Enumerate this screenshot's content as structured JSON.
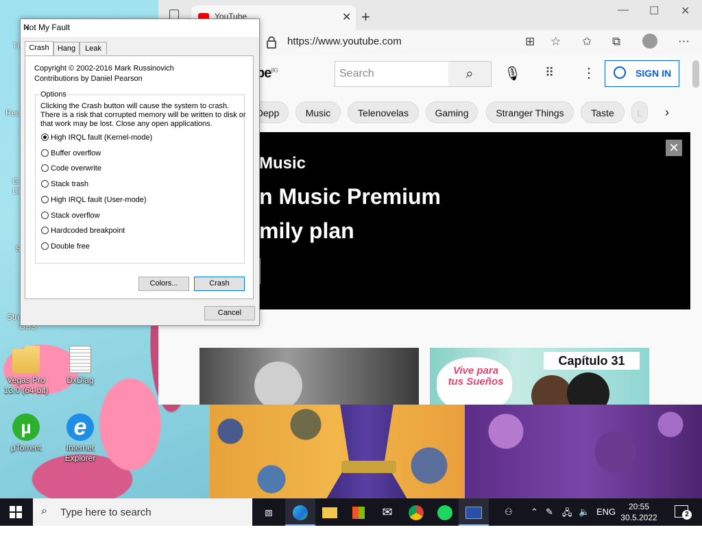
{
  "desktop": {
    "icons": [
      {
        "label": "Vegas Pro 13.0 (64-bit)"
      },
      {
        "label": "DxDiag"
      },
      {
        "label": "µTorrent"
      },
      {
        "label": "Internet Explorer"
      }
    ],
    "edge_labels": [
      "Th",
      "Rec",
      "G",
      "Ch",
      "S",
      "Stre",
      "OBS"
    ]
  },
  "browser": {
    "tab_title": "YouTube",
    "url": "https://www.youtube.com",
    "youtube": {
      "logo_suffix": "be",
      "country": "BG",
      "search_placeholder": "Search",
      "sign_in": "SIGN IN",
      "chips": [
        "Depp",
        "Music",
        "Telenovelas",
        "Gaming",
        "Stranger Things",
        "Taste",
        "L"
      ],
      "ad": {
        "line1": "Music",
        "line2": "n Music Premium",
        "line3": "mily plan"
      },
      "thumbs": {
        "thumb2_heart": "Vive para tus Sueños",
        "thumb2_caption": "Capítulo 31"
      }
    }
  },
  "dialog": {
    "title": "Not My Fault",
    "tabs": [
      "Crash",
      "Hang",
      "Leak"
    ],
    "active_tab": "Crash",
    "copyright": "Copyright © 2002-2016 Mark Russinovich",
    "contributions": "Contributions by Daniel Pearson",
    "options_legend": "Options",
    "options_description": "Clicking the Crash button will cause the system to crash. There is a risk that corrupted memory will be written to disk or that work may be lost. Close any open applications.",
    "options": [
      {
        "label": "High IRQL fault (Kernel-mode)",
        "selected": true
      },
      {
        "label": "Buffer overflow",
        "selected": false
      },
      {
        "label": "Code overwrite",
        "selected": false
      },
      {
        "label": "Stack trash",
        "selected": false
      },
      {
        "label": "High IRQL fault (User-mode)",
        "selected": false
      },
      {
        "label": "Stack overflow",
        "selected": false
      },
      {
        "label": "Hardcoded breakpoint",
        "selected": false
      },
      {
        "label": "Double free",
        "selected": false
      }
    ],
    "colors_button": "Colors...",
    "crash_button": "Crash",
    "cancel_button": "Cancel"
  },
  "taskbar": {
    "search_placeholder": "Type here to search",
    "language": "ENG",
    "time": "20:55",
    "date": "30.5.2022 г.",
    "notification_count": "2"
  },
  "colors": {
    "youtube_blue": "#065fd4",
    "taskbar": "#14141c"
  }
}
